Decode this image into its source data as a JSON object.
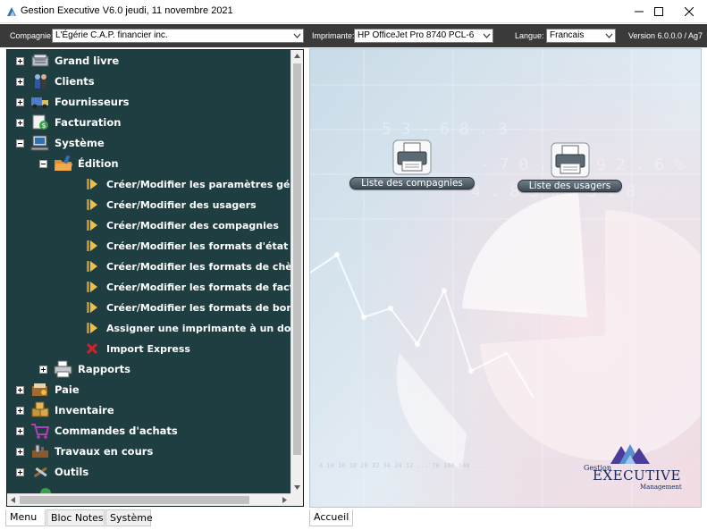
{
  "window": {
    "title": "Gestion Executive V6.0   jeudi, 11 novembre 2021",
    "controls": [
      "minimize-icon",
      "maximize-icon",
      "close-icon"
    ]
  },
  "toolbar": {
    "company_label": "Compagnie:",
    "company_value": "L'Égérie C.A.P. financier inc.",
    "printer_label": "Imprimante:",
    "printer_value": "HP OfficeJet Pro 8740 PCL-6",
    "language_label": "Langue:",
    "language_value": "Francais",
    "version": "Version 6.0.0.0 / Ag7"
  },
  "tree": {
    "items": [
      {
        "label": "Grand livre",
        "icon": "ledger-icon",
        "expander": "plus"
      },
      {
        "label": "Clients",
        "icon": "clients-icon",
        "expander": "plus"
      },
      {
        "label": "Fournisseurs",
        "icon": "truck-icon",
        "expander": "plus"
      },
      {
        "label": "Facturation",
        "icon": "invoice-icon",
        "expander": "plus"
      },
      {
        "label": "Système",
        "icon": "computer-icon",
        "expander": "minus"
      },
      {
        "label": "Édition",
        "icon": "folder-icon",
        "expander": "minus"
      },
      {
        "label": "Créer/Modifier les paramètres généraux",
        "icon": "arrow-icon"
      },
      {
        "label": "Créer/Modifier des usagers",
        "icon": "arrow-icon"
      },
      {
        "label": "Créer/Modifier des compagnies",
        "icon": "arrow-icon"
      },
      {
        "label": "Créer/Modifier les formats d'état de comptes",
        "icon": "arrow-icon"
      },
      {
        "label": "Créer/Modifier les formats de chèque fournisseur",
        "icon": "arrow-icon"
      },
      {
        "label": "Créer/Modifier les formats de factures/crédits",
        "icon": "arrow-icon"
      },
      {
        "label": "Créer/Modifier les formats de bon d'achat",
        "icon": "arrow-icon"
      },
      {
        "label": "Assigner une imprimante à un document",
        "icon": "arrow-icon"
      },
      {
        "label": "Import Express",
        "icon": "red-x-icon"
      },
      {
        "label": "Rapports",
        "icon": "printer-icon",
        "expander": "plus"
      },
      {
        "label": "Paie",
        "icon": "payroll-icon",
        "expander": "plus"
      },
      {
        "label": "Inventaire",
        "icon": "inventory-icon",
        "expander": "plus"
      },
      {
        "label": "Commandes d'achats",
        "icon": "cart-icon",
        "expander": "plus"
      },
      {
        "label": "Travaux en cours",
        "icon": "work-icon",
        "expander": "plus"
      },
      {
        "label": "Outils",
        "icon": "tools-icon",
        "expander": "plus"
      }
    ]
  },
  "bottom_tabs": {
    "menu": "Menu",
    "notes": "Bloc Notes",
    "system": "Système",
    "home": "Accueil"
  },
  "canvas": {
    "companies_list": "Liste des compagnies",
    "users_list": "Liste des usagers"
  },
  "brand": {
    "line1": "Gestion",
    "line2": "EXECUTIVE",
    "line3": "Management"
  },
  "colors": {
    "tree_bg": "#1e3e42",
    "toolbar_bg": "#3a3a3a",
    "canvas_bg": "#d7e4ee"
  }
}
